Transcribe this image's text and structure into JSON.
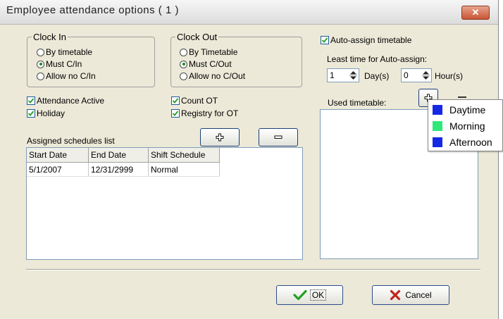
{
  "window": {
    "title": "Employee attendance options ( 1 )",
    "close_glyph": "✕"
  },
  "clock_in": {
    "legend": "Clock In",
    "options": [
      "By timetable",
      "Must C/In",
      "Allow no C/In"
    ],
    "selected_index": 1
  },
  "clock_out": {
    "legend": "Clock Out",
    "options": [
      "By Timetable",
      "Must C/Out",
      "Allow no C/Out"
    ],
    "selected_index": 1
  },
  "checks": {
    "attendance_active": {
      "label": "Attendance Active",
      "checked": true
    },
    "holiday": {
      "label": "Holiday",
      "checked": true
    },
    "count_ot": {
      "label": "Count OT",
      "checked": true
    },
    "registry_ot": {
      "label": "Registry for OT",
      "checked": true
    },
    "auto_assign": {
      "label": "Auto-assign timetable",
      "checked": true
    }
  },
  "auto_assign": {
    "least_time_label": "Least time for Auto-assign:",
    "days_value": "1",
    "days_unit": "Day(s)",
    "hours_value": "0",
    "hours_unit": "Hour(s)"
  },
  "schedules": {
    "label": "Assigned schedules list",
    "columns": [
      "Start Date",
      "End Date",
      "Shift Schedule"
    ],
    "rows": [
      [
        "5/1/2007",
        "12/31/2999",
        "Normal"
      ]
    ]
  },
  "used_timetable": {
    "label": "Used timetable:"
  },
  "timetable_menu": [
    {
      "name": "Daytime",
      "color": "#1428e6"
    },
    {
      "name": "Morning",
      "color": "#2ee87a"
    },
    {
      "name": "Afternoon",
      "color": "#1428e6"
    }
  ],
  "icons": {
    "add": "plus-icon",
    "remove": "minus-icon",
    "ok": "check-icon",
    "cancel": "x-icon"
  },
  "buttons": {
    "ok": "OK",
    "cancel": "Cancel"
  }
}
